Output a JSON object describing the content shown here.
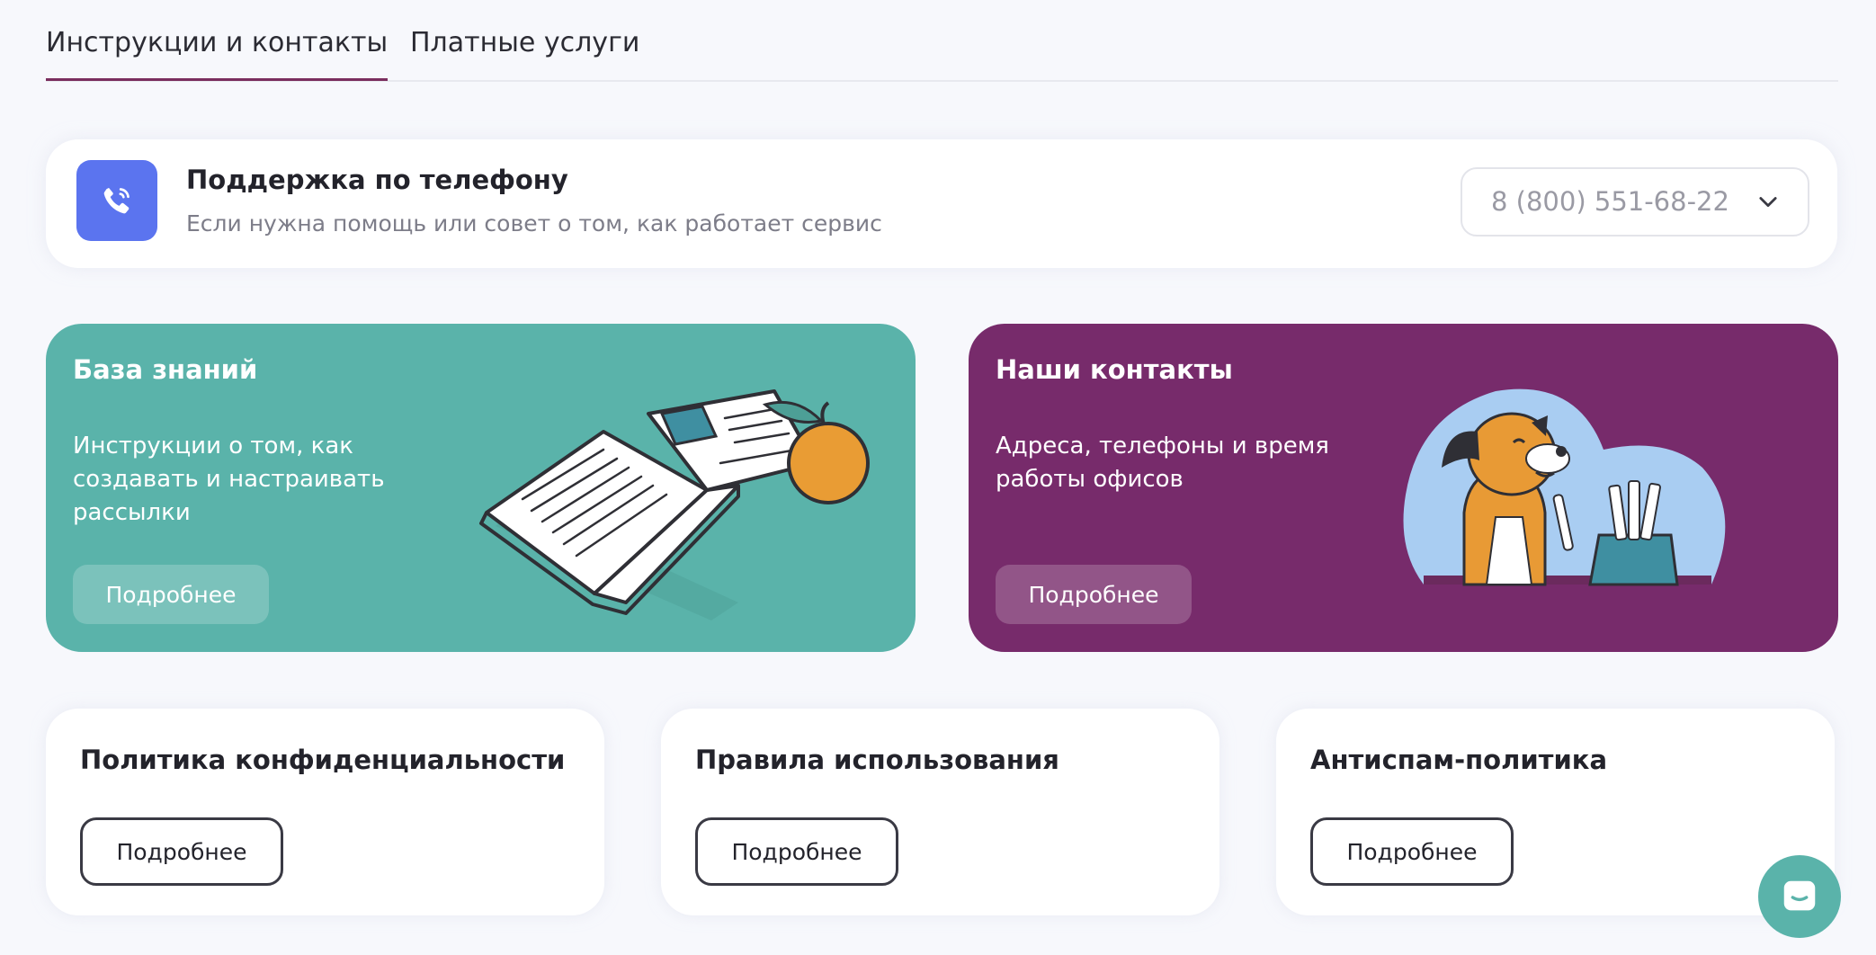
{
  "tabs": [
    {
      "label": "Инструкции и контакты",
      "active": true
    },
    {
      "label": "Платные услуги",
      "active": false
    }
  ],
  "support": {
    "icon": "phone-icon",
    "title": "Поддержка по телефону",
    "subtitle": "Если нужна помощь или совет о том, как работает сервис",
    "phone": "8 (800) 551-68-22"
  },
  "cards": [
    {
      "title": "База знаний",
      "description": "Инструкции о том, как создавать и настраивать рассылки",
      "button": "Подробнее",
      "color": "#5ab3aa"
    },
    {
      "title": "Наши контакты",
      "description": "Адреса, телефоны и время работы офисов",
      "button": "Подробнее",
      "color": "#772b6b"
    }
  ],
  "policies": [
    {
      "title": "Политика конфиденциальности",
      "button": "Подробнее"
    },
    {
      "title": "Правила использования",
      "button": "Подробнее"
    },
    {
      "title": "Антиспам-политика",
      "button": "Подробнее"
    }
  ],
  "colors": {
    "accent": "#7a2d5e",
    "phone_icon_bg": "#5b74ef",
    "chat": "#5ab3aa"
  }
}
